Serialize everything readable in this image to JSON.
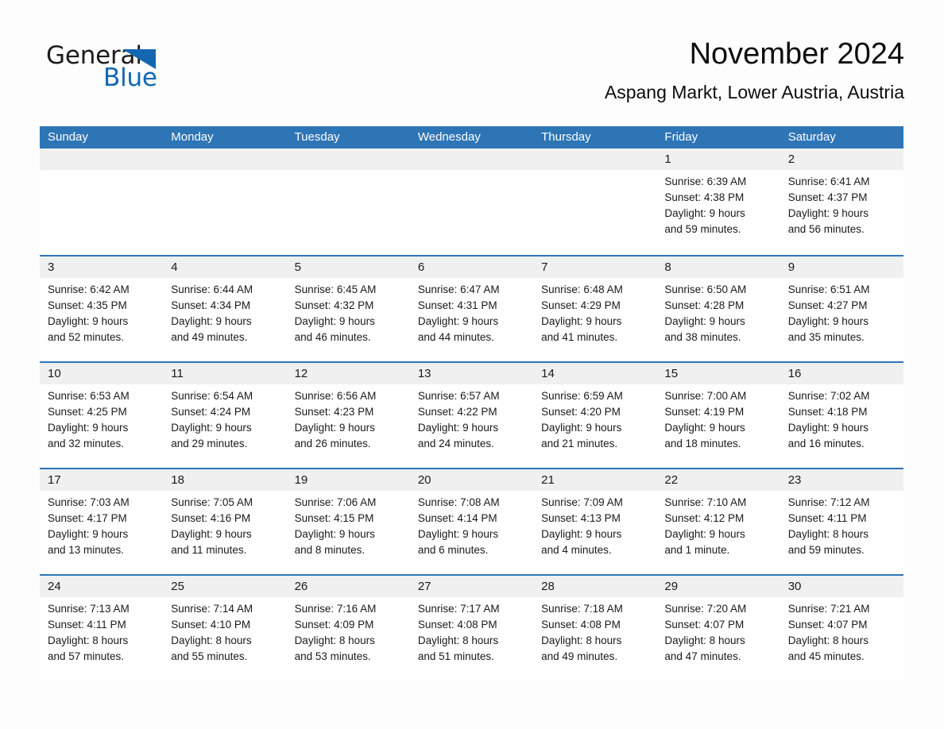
{
  "logo": {
    "text_primary": "General",
    "text_secondary": "Blue",
    "triangle_color": "#1367b0"
  },
  "header": {
    "title": "November 2024",
    "subtitle": "Aspang Markt, Lower Austria, Austria"
  },
  "colors": {
    "header_blue": "#2e75b6",
    "day_number_bg": "#f0f0f0",
    "page_bg": "#fdfdfd",
    "text": "#1a1a1a"
  },
  "weekdays": [
    "Sunday",
    "Monday",
    "Tuesday",
    "Wednesday",
    "Thursday",
    "Friday",
    "Saturday"
  ],
  "weeks": [
    [
      {
        "day": "",
        "lines": []
      },
      {
        "day": "",
        "lines": []
      },
      {
        "day": "",
        "lines": []
      },
      {
        "day": "",
        "lines": []
      },
      {
        "day": "",
        "lines": []
      },
      {
        "day": "1",
        "lines": [
          "Sunrise: 6:39 AM",
          "Sunset: 4:38 PM",
          "Daylight: 9 hours",
          "and 59 minutes."
        ]
      },
      {
        "day": "2",
        "lines": [
          "Sunrise: 6:41 AM",
          "Sunset: 4:37 PM",
          "Daylight: 9 hours",
          "and 56 minutes."
        ]
      }
    ],
    [
      {
        "day": "3",
        "lines": [
          "Sunrise: 6:42 AM",
          "Sunset: 4:35 PM",
          "Daylight: 9 hours",
          "and 52 minutes."
        ]
      },
      {
        "day": "4",
        "lines": [
          "Sunrise: 6:44 AM",
          "Sunset: 4:34 PM",
          "Daylight: 9 hours",
          "and 49 minutes."
        ]
      },
      {
        "day": "5",
        "lines": [
          "Sunrise: 6:45 AM",
          "Sunset: 4:32 PM",
          "Daylight: 9 hours",
          "and 46 minutes."
        ]
      },
      {
        "day": "6",
        "lines": [
          "Sunrise: 6:47 AM",
          "Sunset: 4:31 PM",
          "Daylight: 9 hours",
          "and 44 minutes."
        ]
      },
      {
        "day": "7",
        "lines": [
          "Sunrise: 6:48 AM",
          "Sunset: 4:29 PM",
          "Daylight: 9 hours",
          "and 41 minutes."
        ]
      },
      {
        "day": "8",
        "lines": [
          "Sunrise: 6:50 AM",
          "Sunset: 4:28 PM",
          "Daylight: 9 hours",
          "and 38 minutes."
        ]
      },
      {
        "day": "9",
        "lines": [
          "Sunrise: 6:51 AM",
          "Sunset: 4:27 PM",
          "Daylight: 9 hours",
          "and 35 minutes."
        ]
      }
    ],
    [
      {
        "day": "10",
        "lines": [
          "Sunrise: 6:53 AM",
          "Sunset: 4:25 PM",
          "Daylight: 9 hours",
          "and 32 minutes."
        ]
      },
      {
        "day": "11",
        "lines": [
          "Sunrise: 6:54 AM",
          "Sunset: 4:24 PM",
          "Daylight: 9 hours",
          "and 29 minutes."
        ]
      },
      {
        "day": "12",
        "lines": [
          "Sunrise: 6:56 AM",
          "Sunset: 4:23 PM",
          "Daylight: 9 hours",
          "and 26 minutes."
        ]
      },
      {
        "day": "13",
        "lines": [
          "Sunrise: 6:57 AM",
          "Sunset: 4:22 PM",
          "Daylight: 9 hours",
          "and 24 minutes."
        ]
      },
      {
        "day": "14",
        "lines": [
          "Sunrise: 6:59 AM",
          "Sunset: 4:20 PM",
          "Daylight: 9 hours",
          "and 21 minutes."
        ]
      },
      {
        "day": "15",
        "lines": [
          "Sunrise: 7:00 AM",
          "Sunset: 4:19 PM",
          "Daylight: 9 hours",
          "and 18 minutes."
        ]
      },
      {
        "day": "16",
        "lines": [
          "Sunrise: 7:02 AM",
          "Sunset: 4:18 PM",
          "Daylight: 9 hours",
          "and 16 minutes."
        ]
      }
    ],
    [
      {
        "day": "17",
        "lines": [
          "Sunrise: 7:03 AM",
          "Sunset: 4:17 PM",
          "Daylight: 9 hours",
          "and 13 minutes."
        ]
      },
      {
        "day": "18",
        "lines": [
          "Sunrise: 7:05 AM",
          "Sunset: 4:16 PM",
          "Daylight: 9 hours",
          "and 11 minutes."
        ]
      },
      {
        "day": "19",
        "lines": [
          "Sunrise: 7:06 AM",
          "Sunset: 4:15 PM",
          "Daylight: 9 hours",
          "and 8 minutes."
        ]
      },
      {
        "day": "20",
        "lines": [
          "Sunrise: 7:08 AM",
          "Sunset: 4:14 PM",
          "Daylight: 9 hours",
          "and 6 minutes."
        ]
      },
      {
        "day": "21",
        "lines": [
          "Sunrise: 7:09 AM",
          "Sunset: 4:13 PM",
          "Daylight: 9 hours",
          "and 4 minutes."
        ]
      },
      {
        "day": "22",
        "lines": [
          "Sunrise: 7:10 AM",
          "Sunset: 4:12 PM",
          "Daylight: 9 hours",
          "and 1 minute."
        ]
      },
      {
        "day": "23",
        "lines": [
          "Sunrise: 7:12 AM",
          "Sunset: 4:11 PM",
          "Daylight: 8 hours",
          "and 59 minutes."
        ]
      }
    ],
    [
      {
        "day": "24",
        "lines": [
          "Sunrise: 7:13 AM",
          "Sunset: 4:11 PM",
          "Daylight: 8 hours",
          "and 57 minutes."
        ]
      },
      {
        "day": "25",
        "lines": [
          "Sunrise: 7:14 AM",
          "Sunset: 4:10 PM",
          "Daylight: 8 hours",
          "and 55 minutes."
        ]
      },
      {
        "day": "26",
        "lines": [
          "Sunrise: 7:16 AM",
          "Sunset: 4:09 PM",
          "Daylight: 8 hours",
          "and 53 minutes."
        ]
      },
      {
        "day": "27",
        "lines": [
          "Sunrise: 7:17 AM",
          "Sunset: 4:08 PM",
          "Daylight: 8 hours",
          "and 51 minutes."
        ]
      },
      {
        "day": "28",
        "lines": [
          "Sunrise: 7:18 AM",
          "Sunset: 4:08 PM",
          "Daylight: 8 hours",
          "and 49 minutes."
        ]
      },
      {
        "day": "29",
        "lines": [
          "Sunrise: 7:20 AM",
          "Sunset: 4:07 PM",
          "Daylight: 8 hours",
          "and 47 minutes."
        ]
      },
      {
        "day": "30",
        "lines": [
          "Sunrise: 7:21 AM",
          "Sunset: 4:07 PM",
          "Daylight: 8 hours",
          "and 45 minutes."
        ]
      }
    ]
  ]
}
